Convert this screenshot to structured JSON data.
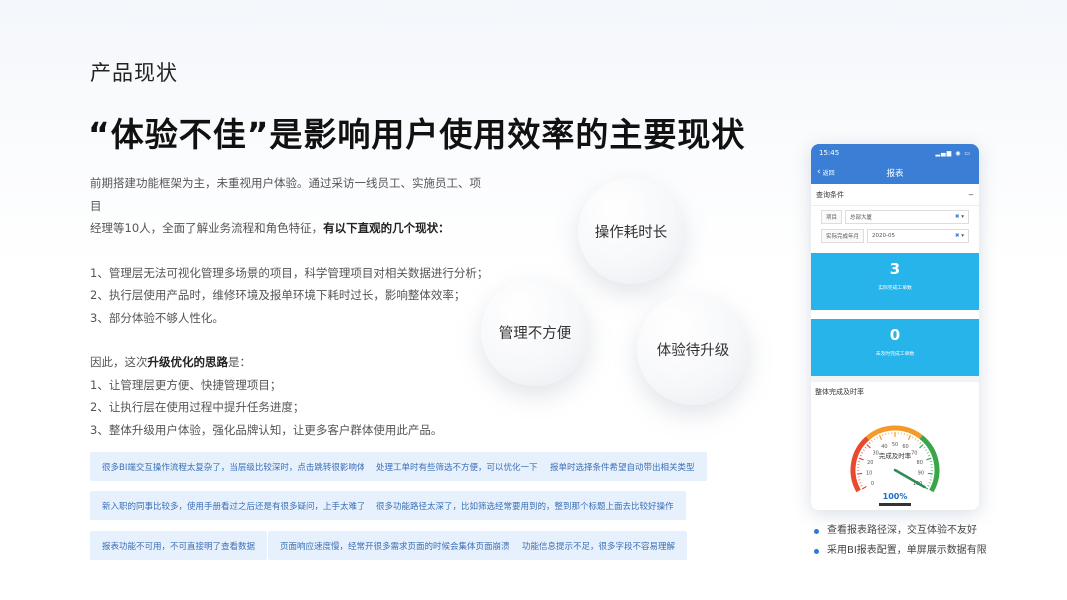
{
  "section_title": "产品现状",
  "headline": "“体验不佳”是影响用户使用效率的主要现状",
  "intro": {
    "line1": "前期搭建功能框架为主，未重视用户体验。通过采访一线员工、实施员工、项目",
    "line2_prefix": "经理等10人，全面了解业务流程和角色特征，",
    "line2_bold": "有以下直观的几个现状："
  },
  "issues": [
    "1、管理层无法可视化管理多场景的项目，科学管理项目对相关数据进行分析；",
    "2、执行层使用产品时，维修环境及报单环境下耗时过长，影响整体效率；",
    "3、部分体验不够人性化。"
  ],
  "upgrade": {
    "prefix": "因此，这次",
    "bold": "升级优化的思路",
    "suffix": "是："
  },
  "goals": [
    "1、让管理层更方便、快捷管理项目；",
    "2、让执行层在使用过程中提升任务进度；",
    "3、整体升级用户体验，强化品牌认知，让更多客户群体使用此产品。"
  ],
  "bubbles": [
    "操作耗时长",
    "管理不方便",
    "体验待升级"
  ],
  "tags": [
    "很多BI端交互操作流程太复杂了，当层级比较深时，点击跳转很影响体验",
    "处理工单时有些筛选不方便，可以优化一下",
    "报单时选择条件希望自动带出相关类型",
    "新入职的同事比较多，使用手册看过之后还是有很多疑问，上手太难了",
    "很多功能路径太深了，比如筛选经常要用到的，整到那个标题上面去比较好操作",
    "报表功能不可用，不可直接明了查看数据",
    "页面响应速度慢，经常开很多需求页面的时候会集体页面崩溃",
    "功能信息提示不足，很多字段不容易理解"
  ],
  "phone": {
    "time": "15:45",
    "signal": "▂▄▆ ◉ ▭",
    "back_label": "返回",
    "title": "报表",
    "query_label": "查询条件",
    "query_toggle": "−",
    "field1_label": "项目",
    "field1_value": "总部大厦",
    "field2_label": "实际完成年月",
    "field2_value": "2020-05",
    "clear_icon": "✖",
    "dropdown_icon": "▾",
    "card1_value": "3",
    "card1_caption": "实际完成工单数",
    "card2_value": "0",
    "card2_caption": "未及时完成工单数",
    "gauge_section": "整体完成及时率",
    "gauge_title": "完成及时率",
    "gauge_value": 100,
    "gauge_value_label": "100%",
    "gauge_ticks": [
      "0",
      "10",
      "20",
      "30",
      "40",
      "50",
      "60",
      "70",
      "80",
      "90",
      "100"
    ],
    "colors": {
      "primary": "#3a7fd5",
      "card": "#26b4ea",
      "gauge_red": "#e8492f",
      "gauge_orange": "#f39a2a",
      "gauge_green": "#3aa64a",
      "needle": "#2e8b57"
    }
  },
  "bullets": [
    "查看报表路径深，交互体验不友好",
    "采用BI报表配置，单屏展示数据有限"
  ]
}
